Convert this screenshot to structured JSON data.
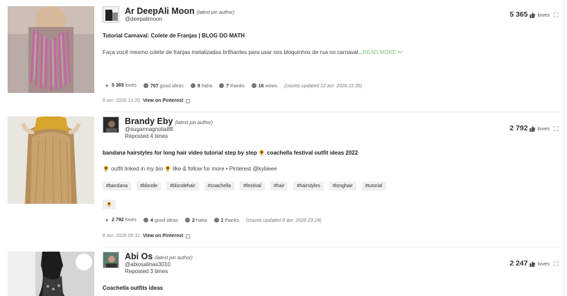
{
  "pins": [
    {
      "author": "Ar DeepAli Moon",
      "author_tag": "(latest pin author)",
      "handle": "@deepalimoon",
      "reposted": "",
      "loves_count": "5 365",
      "loves_label": "loves",
      "title": "Tutorial Carnaval: Colete de Franjas | BLOG DO MATH",
      "description": "Faça você mesmo colete de franjas metalizadas brilhantes para usar nos bloquinhos de rua no carnaval...",
      "read_more": "READ MORE",
      "stats": {
        "loves": "5 365",
        "loves_label": "loves",
        "good_ideas": "707",
        "good_ideas_label": "good ideas",
        "haha": "9",
        "haha_label": "haha",
        "thanks": "7",
        "thanks_label": "thanks",
        "wows": "16",
        "wows_label": "wows",
        "updated": "(counts updated 12 avr. 2026 11:35)"
      },
      "date": "9 avr. 2026 21:20",
      "view_on": "View on Pinterest"
    },
    {
      "author": "Brandy Eby",
      "author_tag": "(latest pin author)",
      "handle": "@sugarmagnolia88",
      "reposted": "Reposted 4 times",
      "loves_count": "2 792",
      "loves_label": "loves",
      "title": "bandana hairstyles for long hair video tutorial step by step 🌻 coachella festival outfit ideas 2022",
      "description": "🌻 outfit linked in my bio 🌻 like & follow for more • Pinterest @kyliieee",
      "hashtags": [
        "#bandana",
        "#blonde",
        "#blondehair",
        "#coachella",
        "#festival",
        "#hair",
        "#hairstyles",
        "#longhair",
        "#tutorial"
      ],
      "emoji_tag": "🌻",
      "stats": {
        "loves": "2 792",
        "loves_label": "loves",
        "good_ideas": "4",
        "good_ideas_label": "good ideas",
        "haha": "2",
        "haha_label": "haha",
        "thanks": "1",
        "thanks_label": "thanks",
        "updated": "(counts updated 9 avr. 2026 23:24)"
      },
      "date": "8 avr. 2026 05:31",
      "view_on": "View on Pinterest"
    },
    {
      "author": "Abi Os",
      "author_tag": "(latest pin author)",
      "handle": "@abiosalinas3010",
      "reposted": "Reposted 3 times",
      "loves_count": "2 247",
      "loves_label": "loves",
      "title": "Coachella outfits ideas"
    }
  ]
}
